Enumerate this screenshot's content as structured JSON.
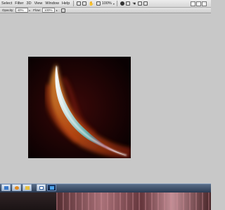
{
  "menubar": {
    "items": [
      "Select",
      "Filter",
      "3D",
      "View",
      "Window",
      "Help"
    ],
    "zoom_value": "100%",
    "zoom_caret": "▾"
  },
  "options": {
    "opacity_label": "Opacity:",
    "opacity_value": "40%",
    "flow_label": "Flow:",
    "flow_value": "100%",
    "caret": "▸"
  },
  "taskbar": {
    "buttons": [
      "explorer-icon",
      "browser-icon",
      "folder-icon",
      "calendar-icon",
      "photoshop-icon"
    ]
  },
  "colors": {
    "background": "#c8c8c8",
    "artwork_background": "#0c0203",
    "flame_orange": "#e0601a",
    "blade_teal": "#5fa9a6"
  }
}
